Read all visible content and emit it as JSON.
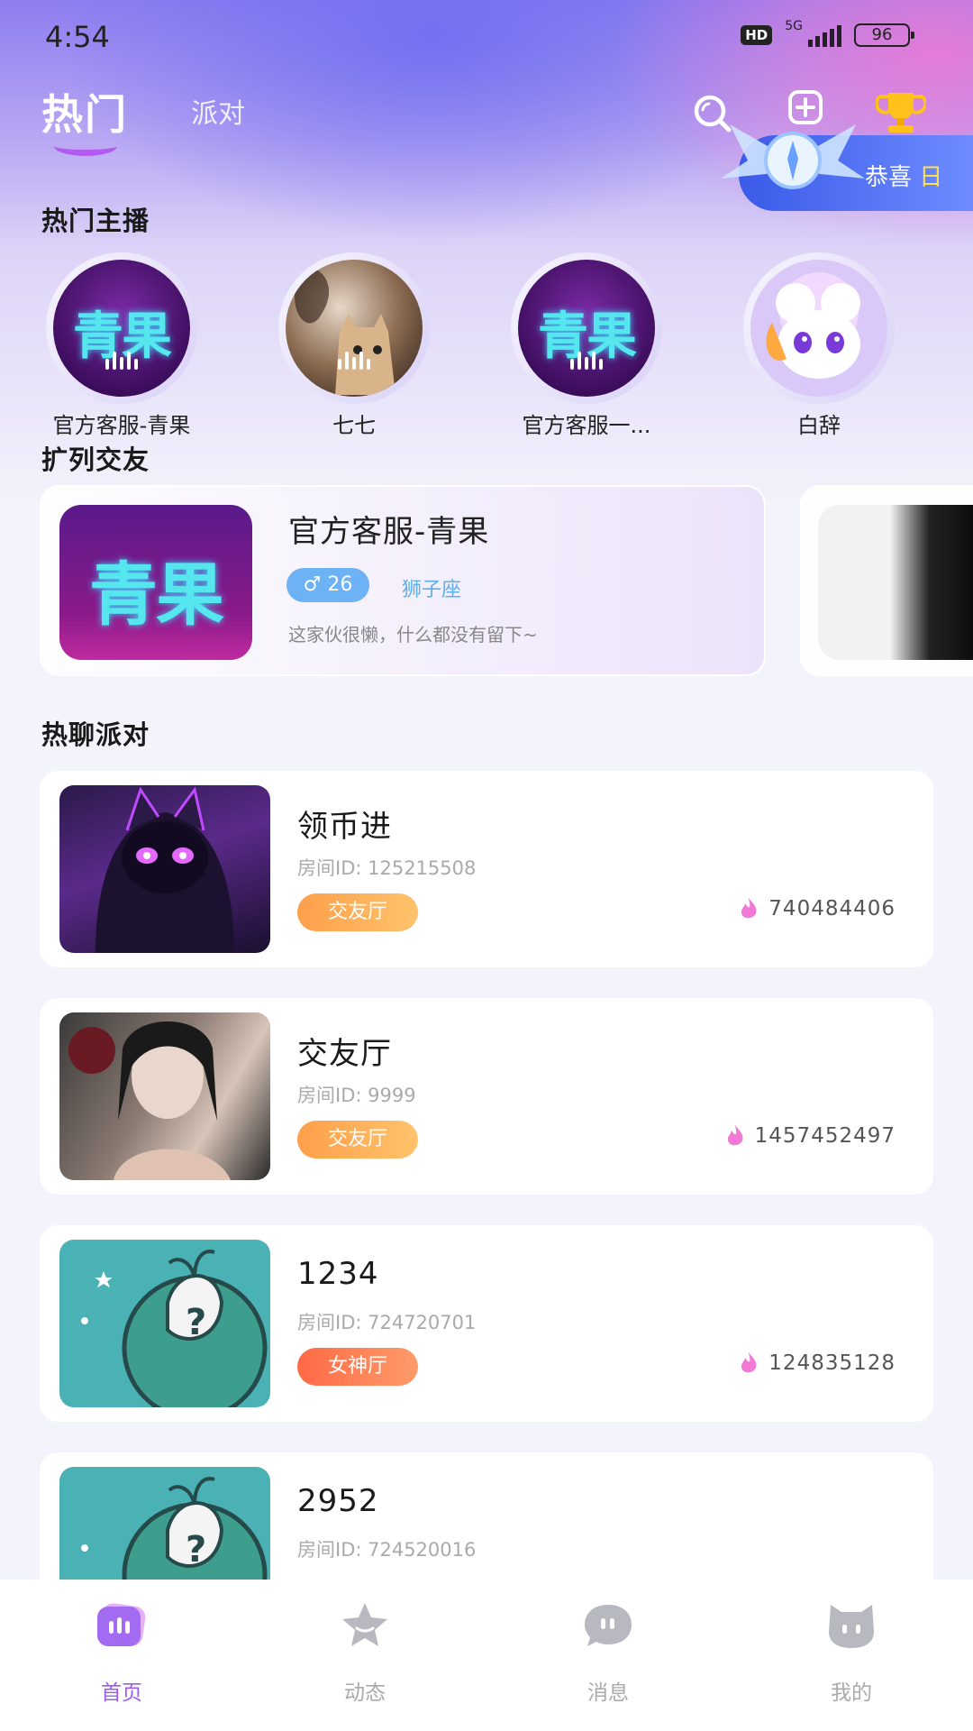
{
  "status_bar": {
    "time": "4:54",
    "hd": "HD",
    "network": "5G",
    "battery": "96"
  },
  "top_nav": {
    "tab_hot": "热门",
    "tab_party": "派对",
    "banner_text": "恭喜",
    "banner_highlight": "日"
  },
  "sections": {
    "hot_anchors": "热门主播",
    "make_friends": "扩列交友",
    "hot_party": "热聊派对"
  },
  "logo_text": "青果",
  "anchors": [
    {
      "name": "官方客服-青果",
      "avatar": "qingguo-logo"
    },
    {
      "name": "七七",
      "avatar": "girl-with-cat"
    },
    {
      "name": "官方客服一...",
      "avatar": "qingguo-logo"
    },
    {
      "name": "白辞",
      "avatar": "cartoon-pet"
    }
  ],
  "friend_card": {
    "name": "官方客服-青果",
    "gender_symbol": "♂",
    "age": "26",
    "zodiac": "狮子座",
    "bio": "这家伙很懒，什么都没有留下~"
  },
  "rooms": [
    {
      "name": "领币进",
      "id_label": "房间ID: 125215508",
      "tag": "交友厅",
      "heat": "740484406"
    },
    {
      "name": "交友厅",
      "id_label": "房间ID: 9999",
      "tag": "交友厅",
      "heat": "1457452497"
    },
    {
      "name": "1234",
      "id_label": "房间ID: 724720701",
      "tag": "女神厅",
      "heat": "124835128"
    },
    {
      "name": "2952",
      "id_label": "房间ID: 724520016",
      "tag": "",
      "heat": ""
    }
  ],
  "bottom_tabs": [
    {
      "label": "首页",
      "icon": "home-icon",
      "active": true
    },
    {
      "label": "动态",
      "icon": "star-icon",
      "active": false
    },
    {
      "label": "消息",
      "icon": "chat-icon",
      "active": false
    },
    {
      "label": "我的",
      "icon": "profile-icon",
      "active": false
    }
  ],
  "colors": {
    "accent": "#9a5cf0",
    "tag_orange": "#ff9f4a",
    "tag_red": "#ff6a45",
    "gender_blue": "#6cb2f5"
  }
}
